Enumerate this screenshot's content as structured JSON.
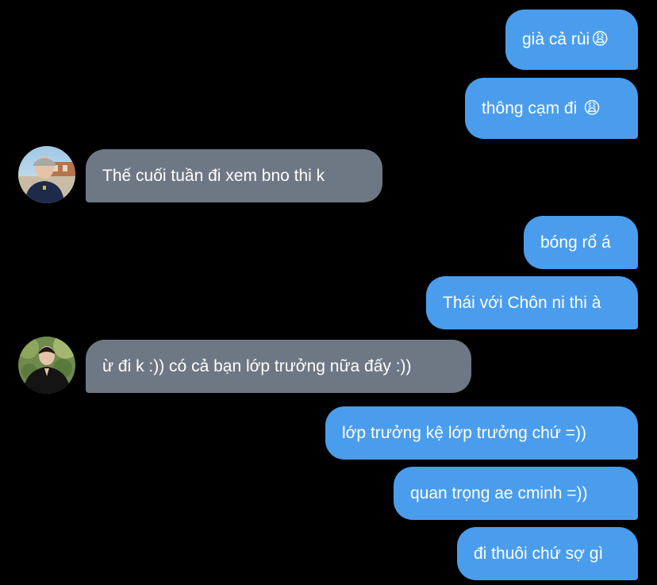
{
  "colors": {
    "background": "#000000",
    "outgoing_bubble": "#4a9ded",
    "incoming_bubble": "#6e7884",
    "text": "#ffffff"
  },
  "messages": [
    {
      "direction": "outgoing",
      "text": "già cả rùi",
      "emoji": "😩",
      "emoji_icon": "weary-face-emoji"
    },
    {
      "direction": "outgoing",
      "text": "thông cạm đi ",
      "emoji": "😩",
      "emoji_icon": "weary-face-emoji"
    },
    {
      "direction": "incoming",
      "text": "Thế cuối tuần đi xem bno thi k",
      "avatar_icon": "contact-avatar-photo"
    },
    {
      "direction": "outgoing",
      "text": "bóng rổ á"
    },
    {
      "direction": "outgoing",
      "text": "Thái với Chôn ni thi à"
    },
    {
      "direction": "incoming",
      "text": "ừ đi k :)) có cả bạn lớp trưởng nữa đấy :))",
      "avatar_icon": "contact-avatar-photo"
    },
    {
      "direction": "outgoing",
      "text": "lớp trưởng kệ lớp trưởng chứ =))"
    },
    {
      "direction": "outgoing",
      "text": "quan trọng ae cminh =))"
    },
    {
      "direction": "outgoing",
      "text": "đi thuôi chứ sợ gì"
    }
  ]
}
